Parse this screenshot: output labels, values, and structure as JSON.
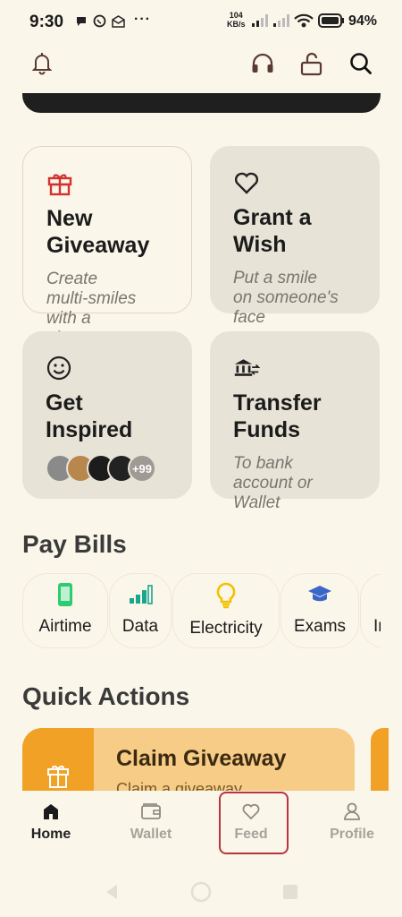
{
  "status_bar": {
    "time": "9:30",
    "net_speed_value": "104",
    "net_speed_unit": "KB/s",
    "battery": "94%"
  },
  "cards": [
    {
      "title": "New\nGiveaway",
      "subtitle": "Create\nmulti-smiles\nwith a\ngiveaway",
      "icon": "gift-box-icon"
    },
    {
      "title": "Grant a\nWish",
      "subtitle": "Put a smile\non someone's\nface",
      "icon": "heart-icon"
    },
    {
      "title": "Get\nInspired",
      "avatars_more": "+99",
      "icon": "smiley-icon"
    },
    {
      "title": "Transfer\nFunds",
      "subtitle": "To bank\naccount or\nWallet",
      "icon": "bank-transfer-icon"
    }
  ],
  "pay_bills": {
    "title": "Pay Bills",
    "items": [
      {
        "label": "Airtime",
        "icon": "phone-icon"
      },
      {
        "label": "Data",
        "icon": "signal-bars-icon"
      },
      {
        "label": "Electricity",
        "icon": "lightbulb-icon"
      },
      {
        "label": "Exams",
        "icon": "graduation-cap-icon"
      },
      {
        "label": "In",
        "icon": "truncated"
      }
    ]
  },
  "quick_actions": {
    "title": "Quick Actions",
    "card_title": "Claim Giveaway",
    "card_subtitle": "Claim a giveaway"
  },
  "nav": {
    "items": [
      {
        "label": "Home",
        "active": true
      },
      {
        "label": "Wallet",
        "active": false
      },
      {
        "label": "Feed",
        "active": false
      },
      {
        "label": "Profile",
        "active": false
      }
    ]
  },
  "colors": {
    "background": "#fbf6ea",
    "card": "#e8e3d7",
    "giveaway_red": "#d2332f",
    "airtime_green": "#2ecc71",
    "data_teal": "#1aa58d",
    "bulb_yellow": "#f2c200",
    "exam_blue": "#3a67c7",
    "quick_orange": "#f1a226",
    "quick_peach": "#f6cc86",
    "highlight": "#b8343f"
  }
}
